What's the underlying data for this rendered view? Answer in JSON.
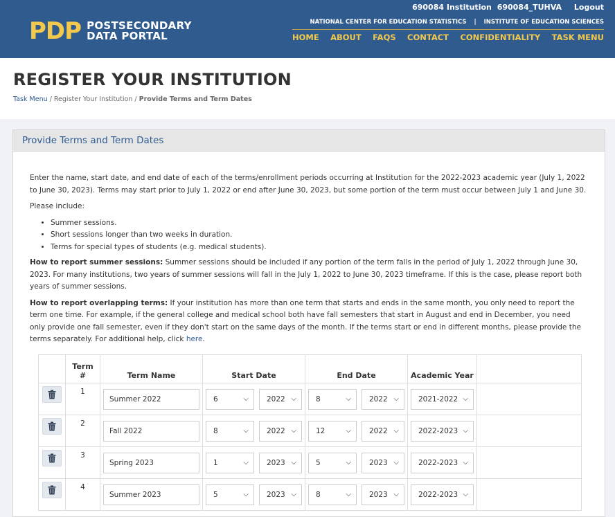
{
  "header": {
    "user": "690084 Institution",
    "user_id": "690084_TUHVA",
    "logout": "Logout",
    "logo_mark": "PDP",
    "logo_line1": "POSTSECONDARY",
    "logo_line2": "DATA PORTAL",
    "agency1": "NATIONAL CENTER FOR EDUCATION STATISTICS",
    "agency_sep": "|",
    "agency2": "INSTITUTE OF EDUCATION SCIENCES",
    "nav": [
      "HOME",
      "ABOUT",
      "FAQS",
      "CONTACT",
      "CONFIDENTIALITY",
      "TASK MENU"
    ],
    "colors": {
      "bg": "#2f5b8f",
      "gold": "#f2c94c"
    }
  },
  "page": {
    "title": "REGISTER YOUR INSTITUTION",
    "breadcrumb": {
      "crumb1": "Task Menu",
      "sep": "/",
      "crumb2": "Register Your Institution",
      "crumb3": "Provide Terms and Term Dates"
    }
  },
  "panel": {
    "title": "Provide Terms and Term Dates",
    "intro": "Enter the name, start date, and end date of each of the terms/enrollment periods occurring at Institution for the 2022-2023 academic year (July 1, 2022 to June 30, 2023). Terms may start prior to July 1, 2022 or end after June 30, 2023, but some portion of the term must occur between July 1 and June 30.",
    "please_include": "Please include:",
    "include_items": [
      "Summer sessions.",
      "Short sessions longer than two weeks in duration.",
      "Terms for special types of students (e.g. medical students)."
    ],
    "summer_label": "How to report summer sessions:",
    "summer_text": " Summer sessions should be included if any portion of the term falls in the period of July 1, 2022 through June 30, 2023. For many institutions, two years of summer sessions will fall in the July 1, 2022 to June 30, 2023 timeframe. If this is the case, please report both years of summer sessions.",
    "overlap_label": "How to report overlapping terms:",
    "overlap_text": " If your institution has more than one term that starts and ends in the same month, you only need to report the term one time. For example, if the general college and medical school both have fall semesters that start in August and end in December, you need only provide one fall semester, even if they don't start on the same days of the month. If the terms start or end in different months, please provide the terms separately. For additional help, click ",
    "help_link": "here",
    "help_end": "."
  },
  "table": {
    "headers": {
      "term_num_1": "Term",
      "term_num_2": "#",
      "term_name": "Term Name",
      "start_date": "Start Date",
      "end_date": "End Date",
      "academic_year": "Academic Year"
    },
    "rows": [
      {
        "num": "1",
        "name": "Summer 2022",
        "start_month": "6",
        "start_year": "2022",
        "end_month": "8",
        "end_year": "2022",
        "academic_year": "2021-2022"
      },
      {
        "num": "2",
        "name": "Fall 2022",
        "start_month": "8",
        "start_year": "2022",
        "end_month": "12",
        "end_year": "2022",
        "academic_year": "2022-2023"
      },
      {
        "num": "3",
        "name": "Spring 2023",
        "start_month": "1",
        "start_year": "2023",
        "end_month": "5",
        "end_year": "2023",
        "academic_year": "2022-2023"
      },
      {
        "num": "4",
        "name": "Summer 2023",
        "start_month": "5",
        "start_year": "2023",
        "end_month": "8",
        "end_year": "2023",
        "academic_year": "2022-2023"
      }
    ]
  },
  "icons": {
    "delete": "trash-icon",
    "dropdown": "chevron-down-icon"
  }
}
